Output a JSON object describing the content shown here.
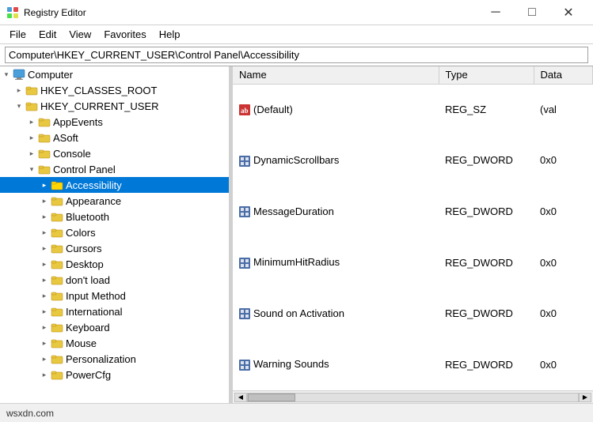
{
  "window": {
    "title": "Registry Editor",
    "icon": "registry-icon"
  },
  "titlebar": {
    "minimize": "─",
    "maximize": "□",
    "close": "✕"
  },
  "menu": {
    "items": [
      "File",
      "Edit",
      "View",
      "Favorites",
      "Help"
    ]
  },
  "address": {
    "label": "Computer\\HKEY_CURRENT_USER\\Control Panel\\Accessibility"
  },
  "tree": {
    "items": [
      {
        "id": "computer",
        "label": "Computer",
        "indent": 1,
        "expanded": true,
        "type": "computer"
      },
      {
        "id": "hkey-classes",
        "label": "HKEY_CLASSES_ROOT",
        "indent": 2,
        "expanded": false,
        "type": "folder"
      },
      {
        "id": "hkey-current",
        "label": "HKEY_CURRENT_USER",
        "indent": 2,
        "expanded": true,
        "type": "folder"
      },
      {
        "id": "appevents",
        "label": "AppEvents",
        "indent": 3,
        "expanded": false,
        "type": "folder"
      },
      {
        "id": "asoft",
        "label": "ASoft",
        "indent": 3,
        "expanded": false,
        "type": "folder"
      },
      {
        "id": "console",
        "label": "Console",
        "indent": 3,
        "expanded": false,
        "type": "folder"
      },
      {
        "id": "control-panel",
        "label": "Control Panel",
        "indent": 3,
        "expanded": true,
        "type": "folder"
      },
      {
        "id": "accessibility",
        "label": "Accessibility",
        "indent": 4,
        "expanded": false,
        "type": "folder",
        "selected": true
      },
      {
        "id": "appearance",
        "label": "Appearance",
        "indent": 4,
        "expanded": false,
        "type": "folder"
      },
      {
        "id": "bluetooth",
        "label": "Bluetooth",
        "indent": 4,
        "expanded": false,
        "type": "folder"
      },
      {
        "id": "colors",
        "label": "Colors",
        "indent": 4,
        "expanded": false,
        "type": "folder"
      },
      {
        "id": "cursors",
        "label": "Cursors",
        "indent": 4,
        "expanded": false,
        "type": "folder"
      },
      {
        "id": "desktop",
        "label": "Desktop",
        "indent": 4,
        "expanded": false,
        "type": "folder"
      },
      {
        "id": "dontload",
        "label": "don't load",
        "indent": 4,
        "expanded": false,
        "type": "folder"
      },
      {
        "id": "inputmethod",
        "label": "Input Method",
        "indent": 4,
        "expanded": false,
        "type": "folder"
      },
      {
        "id": "international",
        "label": "International",
        "indent": 4,
        "expanded": false,
        "type": "folder"
      },
      {
        "id": "keyboard",
        "label": "Keyboard",
        "indent": 4,
        "expanded": false,
        "type": "folder"
      },
      {
        "id": "mouse",
        "label": "Mouse",
        "indent": 4,
        "expanded": false,
        "type": "folder"
      },
      {
        "id": "personalization",
        "label": "Personalization",
        "indent": 4,
        "expanded": false,
        "type": "folder"
      },
      {
        "id": "powercfg",
        "label": "PowerCfg",
        "indent": 4,
        "expanded": false,
        "type": "folder"
      }
    ]
  },
  "registry_table": {
    "columns": [
      "Name",
      "Type",
      "Data"
    ],
    "rows": [
      {
        "name": "(Default)",
        "type": "REG_SZ",
        "data": "(val",
        "icon": "ab"
      },
      {
        "name": "DynamicScrollbars",
        "type": "REG_DWORD",
        "data": "0x0",
        "icon": "grid"
      },
      {
        "name": "MessageDuration",
        "type": "REG_DWORD",
        "data": "0x0",
        "icon": "grid"
      },
      {
        "name": "MinimumHitRadius",
        "type": "REG_DWORD",
        "data": "0x0",
        "icon": "grid"
      },
      {
        "name": "Sound on Activation",
        "type": "REG_DWORD",
        "data": "0x0",
        "icon": "grid"
      },
      {
        "name": "Warning Sounds",
        "type": "REG_DWORD",
        "data": "0x0",
        "icon": "grid"
      }
    ]
  },
  "statusbar": {
    "text": "wsxdn.com"
  }
}
